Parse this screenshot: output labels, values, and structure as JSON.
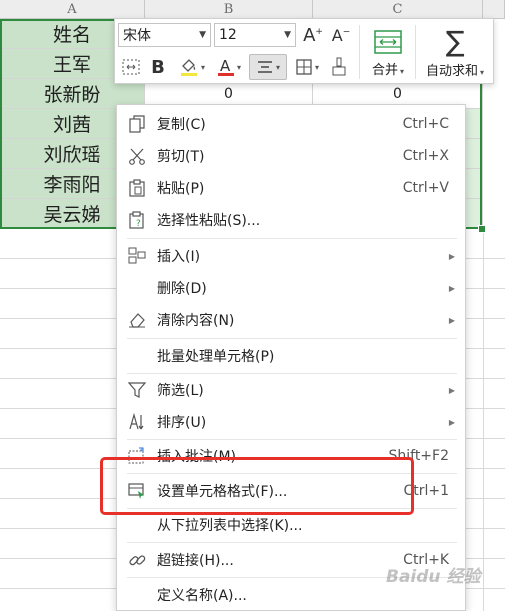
{
  "columns": [
    "A",
    "B",
    "C"
  ],
  "rows": [
    {
      "name": "姓名",
      "b": "",
      "c": ""
    },
    {
      "name": "王军",
      "b": "",
      "c": ""
    },
    {
      "name": "张新盼",
      "b": "0",
      "c": "0"
    },
    {
      "name": "刘茜",
      "b": "",
      "c": ""
    },
    {
      "name": "刘欣瑶",
      "b": "",
      "c": ""
    },
    {
      "name": "李雨阳",
      "b": "",
      "c": ""
    },
    {
      "name": "吴云娣",
      "b": "",
      "c": ""
    }
  ],
  "mini_toolbar": {
    "font_name": "宋体",
    "font_size": "12",
    "merge_label": "合并",
    "autosum_label": "自动求和"
  },
  "context_menu": {
    "items": [
      {
        "label": "复制(C)",
        "shortcut": "Ctrl+C",
        "icon": "copy-icon"
      },
      {
        "label": "剪切(T)",
        "shortcut": "Ctrl+X",
        "icon": "cut-icon"
      },
      {
        "label": "粘贴(P)",
        "shortcut": "Ctrl+V",
        "icon": "paste-icon"
      },
      {
        "label": "选择性粘贴(S)...",
        "shortcut": "",
        "icon": "paste-special-icon"
      },
      {
        "label": "插入(I)",
        "shortcut": "",
        "icon": "insert-icon"
      },
      {
        "label": "删除(D)",
        "shortcut": "",
        "icon": ""
      },
      {
        "label": "清除内容(N)",
        "shortcut": "",
        "icon": "eraser-icon"
      },
      {
        "label": "批量处理单元格(P)",
        "shortcut": "",
        "icon": ""
      },
      {
        "label": "筛选(L)",
        "shortcut": "",
        "icon": "filter-icon"
      },
      {
        "label": "排序(U)",
        "shortcut": "",
        "icon": "sort-icon"
      },
      {
        "label": "插入批注(M)",
        "shortcut": "Shift+F2",
        "icon": "comment-icon"
      },
      {
        "label": "设置单元格格式(F)...",
        "shortcut": "Ctrl+1",
        "icon": "format-cells-icon"
      },
      {
        "label": "从下拉列表中选择(K)...",
        "shortcut": "",
        "icon": ""
      },
      {
        "label": "超链接(H)...",
        "shortcut": "Ctrl+K",
        "icon": "hyperlink-icon"
      },
      {
        "label": "定义名称(A)...",
        "shortcut": "",
        "icon": ""
      }
    ]
  },
  "watermark": "Baidu 经验",
  "colors": {
    "selection_border": "#2e8b3e",
    "selected_fill": "#c9e2c9",
    "highlight_box": "#e8302a",
    "toolbar_icon_green": "#2e9a4a"
  }
}
